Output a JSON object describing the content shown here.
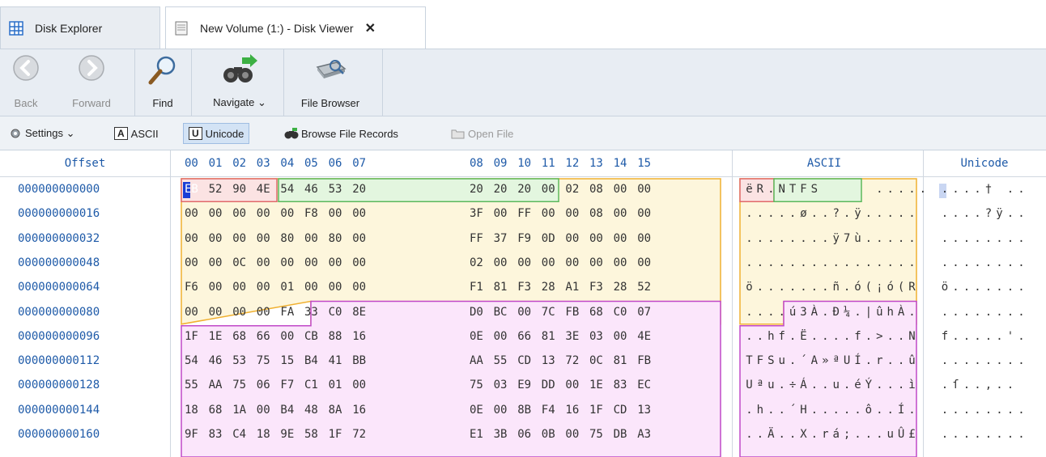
{
  "tabs": [
    {
      "label": "Disk Explorer",
      "icon": "grid-icon",
      "active": false
    },
    {
      "label": "New Volume (1:) - Disk Viewer",
      "icon": "disk-viewer-icon",
      "active": true,
      "close": "✕"
    }
  ],
  "ribbon": {
    "back_label": "Back",
    "forward_label": "Forward",
    "find_label": "Find",
    "navigate_label": "Navigate ⌄",
    "file_browser_label": "File Browser"
  },
  "toolbar": {
    "settings_label": "Settings ⌄",
    "ascii_letter": "A",
    "ascii_label": "ASCII",
    "unicode_letter": "U",
    "unicode_label": "Unicode",
    "browse_label": "Browse File Records",
    "open_file_label": "Open File"
  },
  "headers": {
    "offset": "Offset",
    "bytes": [
      "00",
      "01",
      "02",
      "03",
      "04",
      "05",
      "06",
      "07",
      "08",
      "09",
      "10",
      "11",
      "12",
      "13",
      "14",
      "15"
    ],
    "ascii": "ASCII",
    "unicode": "Unicode"
  },
  "rows": [
    {
      "offset": "000000000000",
      "bytes": [
        "EB",
        "52",
        "90",
        "4E",
        "54",
        "46",
        "53",
        "20",
        "20",
        "20",
        "20",
        "00",
        "02",
        "08",
        "00",
        "00"
      ],
      "ascii": "ëR.NTFS     .....",
      "unicode": "....† .."
    },
    {
      "offset": "000000000016",
      "bytes": [
        "00",
        "00",
        "00",
        "00",
        "00",
        "F8",
        "00",
        "00",
        "3F",
        "00",
        "FF",
        "00",
        "00",
        "08",
        "00",
        "00"
      ],
      "ascii": ".....ø..?.ÿ.....",
      "unicode": "....?ÿ.."
    },
    {
      "offset": "000000000032",
      "bytes": [
        "00",
        "00",
        "00",
        "00",
        "80",
        "00",
        "80",
        "00",
        "FF",
        "37",
        "F9",
        "0D",
        "00",
        "00",
        "00",
        "00"
      ],
      "ascii": "........ÿ7ù.....",
      "unicode": "........"
    },
    {
      "offset": "000000000048",
      "bytes": [
        "00",
        "00",
        "0C",
        "00",
        "00",
        "00",
        "00",
        "00",
        "02",
        "00",
        "00",
        "00",
        "00",
        "00",
        "00",
        "00"
      ],
      "ascii": "................",
      "unicode": "........"
    },
    {
      "offset": "000000000064",
      "bytes": [
        "F6",
        "00",
        "00",
        "00",
        "01",
        "00",
        "00",
        "00",
        "F1",
        "81",
        "F3",
        "28",
        "A1",
        "F3",
        "28",
        "52"
      ],
      "ascii": "ö.......ñ.ó(¡ó(R",
      "unicode": "ö......."
    },
    {
      "offset": "000000000080",
      "bytes": [
        "00",
        "00",
        "00",
        "00",
        "FA",
        "33",
        "C0",
        "8E",
        "D0",
        "BC",
        "00",
        "7C",
        "FB",
        "68",
        "C0",
        "07"
      ],
      "ascii": "....ú3À.Ð¼.|ûhÀ.",
      "unicode": "........"
    },
    {
      "offset": "000000000096",
      "bytes": [
        "1F",
        "1E",
        "68",
        "66",
        "00",
        "CB",
        "88",
        "16",
        "0E",
        "00",
        "66",
        "81",
        "3E",
        "03",
        "00",
        "4E"
      ],
      "ascii": "..hf.Ë....f.>..N",
      "unicode": "f.....'."
    },
    {
      "offset": "000000000112",
      "bytes": [
        "54",
        "46",
        "53",
        "75",
        "15",
        "B4",
        "41",
        "BB",
        "AA",
        "55",
        "CD",
        "13",
        "72",
        "0C",
        "81",
        "FB"
      ],
      "ascii": "TFSu.´A»ªUÍ.r..û",
      "unicode": "........"
    },
    {
      "offset": "000000000128",
      "bytes": [
        "55",
        "AA",
        "75",
        "06",
        "F7",
        "C1",
        "01",
        "00",
        "75",
        "03",
        "E9",
        "DD",
        "00",
        "1E",
        "83",
        "EC"
      ],
      "ascii": "Uªu.÷Á..u.éÝ...ì",
      "unicode": ".ſ..,.."
    },
    {
      "offset": "000000000144",
      "bytes": [
        "18",
        "68",
        "1A",
        "00",
        "B4",
        "48",
        "8A",
        "16",
        "0E",
        "00",
        "8B",
        "F4",
        "16",
        "1F",
        "CD",
        "13"
      ],
      "ascii": ".h..´H.....ô..Í.",
      "unicode": "........"
    },
    {
      "offset": "000000000160",
      "bytes": [
        "9F",
        "83",
        "C4",
        "18",
        "9E",
        "58",
        "1F",
        "72",
        "E1",
        "3B",
        "06",
        "0B",
        "00",
        "75",
        "DB",
        "A3"
      ],
      "ascii": "..Ä..X.rá;...uÛ£",
      "unicode": "........"
    }
  ],
  "colors": {
    "jump_fill": "#fbe3e3",
    "jump_border": "#e06a6a",
    "oem_fill": "#e3f6df",
    "oem_border": "#5cb85c",
    "bpb_fill": "#fdf6dc",
    "bpb_border": "#f0b030",
    "boot_fill": "#fbe6fb",
    "boot_border": "#c048c8",
    "offset_text": "#1e5aa8"
  }
}
